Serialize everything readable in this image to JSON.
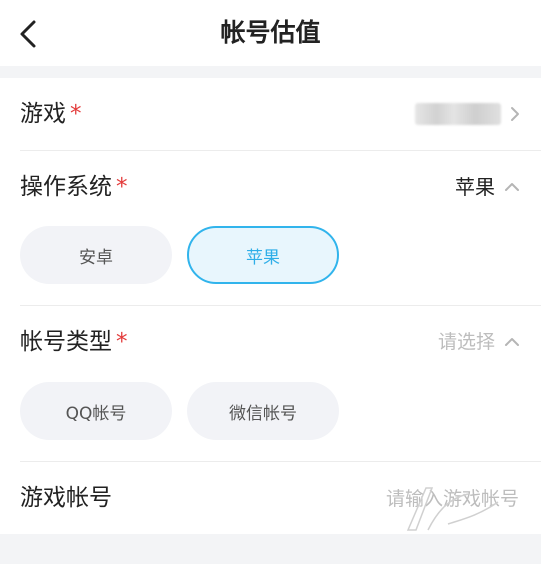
{
  "header": {
    "title": "帐号估值"
  },
  "form": {
    "game": {
      "label": "游戏",
      "required_mark": "*"
    },
    "os": {
      "label": "操作系统",
      "required_mark": "*",
      "value": "苹果",
      "options": [
        {
          "label": "安卓"
        },
        {
          "label": "苹果"
        }
      ]
    },
    "account_type": {
      "label": "帐号类型",
      "required_mark": "*",
      "placeholder": "请选择",
      "options": [
        {
          "label": "QQ帐号"
        },
        {
          "label": "微信帐号"
        }
      ]
    },
    "game_account": {
      "label": "游戏帐号",
      "placeholder": "请输入游戏帐号",
      "value": ""
    }
  },
  "colors": {
    "accent": "#31b4ec",
    "required": "#e33b3b",
    "placeholder": "#bdbdbd"
  }
}
